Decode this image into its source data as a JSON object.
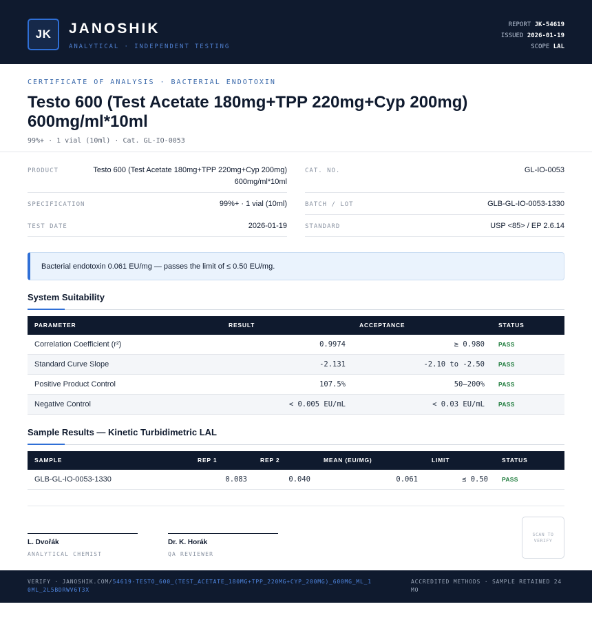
{
  "header": {
    "logo_initials": "JK",
    "brand": "JANOSHIK",
    "tagline": "ANALYTICAL · INDEPENDENT TESTING",
    "report_label": "REPORT",
    "report_value": "JK-54619",
    "issued_label": "ISSUED",
    "issued_value": "2026-01-19",
    "scope_label": "SCOPE",
    "scope_value": "LAL"
  },
  "certificate": {
    "label": "CERTIFICATE OF ANALYSIS · BACTERIAL ENDOTOXIN",
    "title": "Testo 600 (Test Acetate 180mg+TPP 220mg+Cyp 200mg) 600mg/ml*10ml",
    "subline": "99%+ · 1 vial (10ml)  ·  Cat. GL-IO-0053"
  },
  "info": {
    "product_label": "PRODUCT",
    "product_value": "Testo 600 (Test Acetate 180mg+TPP 220mg+Cyp 200mg) 600mg/ml*10ml",
    "cat_label": "CAT. NO.",
    "cat_value": "GL-IO-0053",
    "spec_label": "SPECIFICATION",
    "spec_value": "99%+ · 1 vial (10ml)",
    "batch_label": "BATCH / LOT",
    "batch_value": "GLB-GL-IO-0053-1330",
    "date_label": "TEST DATE",
    "date_value": "2026-01-19",
    "standard_label": "STANDARD",
    "standard_value": "USP <85> / EP 2.6.14"
  },
  "banner": {
    "text": "Bacterial endotoxin 0.061 EU/mg — passes the limit of ≤ 0.50 EU/mg."
  },
  "suitability": {
    "title": "System Suitability",
    "headers": [
      "PARAMETER",
      "RESULT",
      "ACCEPTANCE",
      "STATUS"
    ],
    "rows": [
      {
        "parameter": "Correlation Coefficient (r²)",
        "result": "0.9974",
        "acceptance": "≥ 0.980",
        "status": "PASS"
      },
      {
        "parameter": "Standard Curve Slope",
        "result": "-2.131",
        "acceptance": "-2.10 to -2.50",
        "status": "PASS"
      },
      {
        "parameter": "Positive Product Control",
        "result": "107.5%",
        "acceptance": "50–200%",
        "status": "PASS"
      },
      {
        "parameter": "Negative Control",
        "result": "< 0.005 EU/mL",
        "acceptance": "< 0.03 EU/mL",
        "status": "PASS"
      }
    ]
  },
  "samples": {
    "title": "Sample Results — Kinetic Turbidimetric LAL",
    "headers": [
      "SAMPLE",
      "REP 1",
      "REP 2",
      "MEAN (EU/MG)",
      "LIMIT",
      "STATUS"
    ],
    "rows": [
      {
        "sample": "GLB-GL-IO-0053-1330",
        "rep1": "0.083",
        "rep2": "0.040",
        "mean": "0.061",
        "limit": "≤ 0.50",
        "status": "PASS"
      }
    ]
  },
  "signatures": [
    {
      "name": "L. Dvořák",
      "role": "ANALYTICAL CHEMIST"
    },
    {
      "name": "Dr. K. Horák",
      "role": "QA REVIEWER"
    }
  ],
  "qr": {
    "text": "SCAN TO VERIFY"
  },
  "footer": {
    "verify_prefix": "VERIFY · JANOSHIK.COM/",
    "verify_path": "54619-TESTO_600_(TEST_ACETATE_180MG+TPP_220MG+CYP_200MG)_600MG_ML_10ML_2L5BDRWV6T3X",
    "right_text": "ACCREDITED METHODS · SAMPLE RETAINED 24 MO"
  },
  "colors": {
    "navy": "#0f1a2e",
    "accent": "#2f6fd6",
    "pass": "#1c7a3a",
    "banner_bg": "#eaf3fd"
  }
}
